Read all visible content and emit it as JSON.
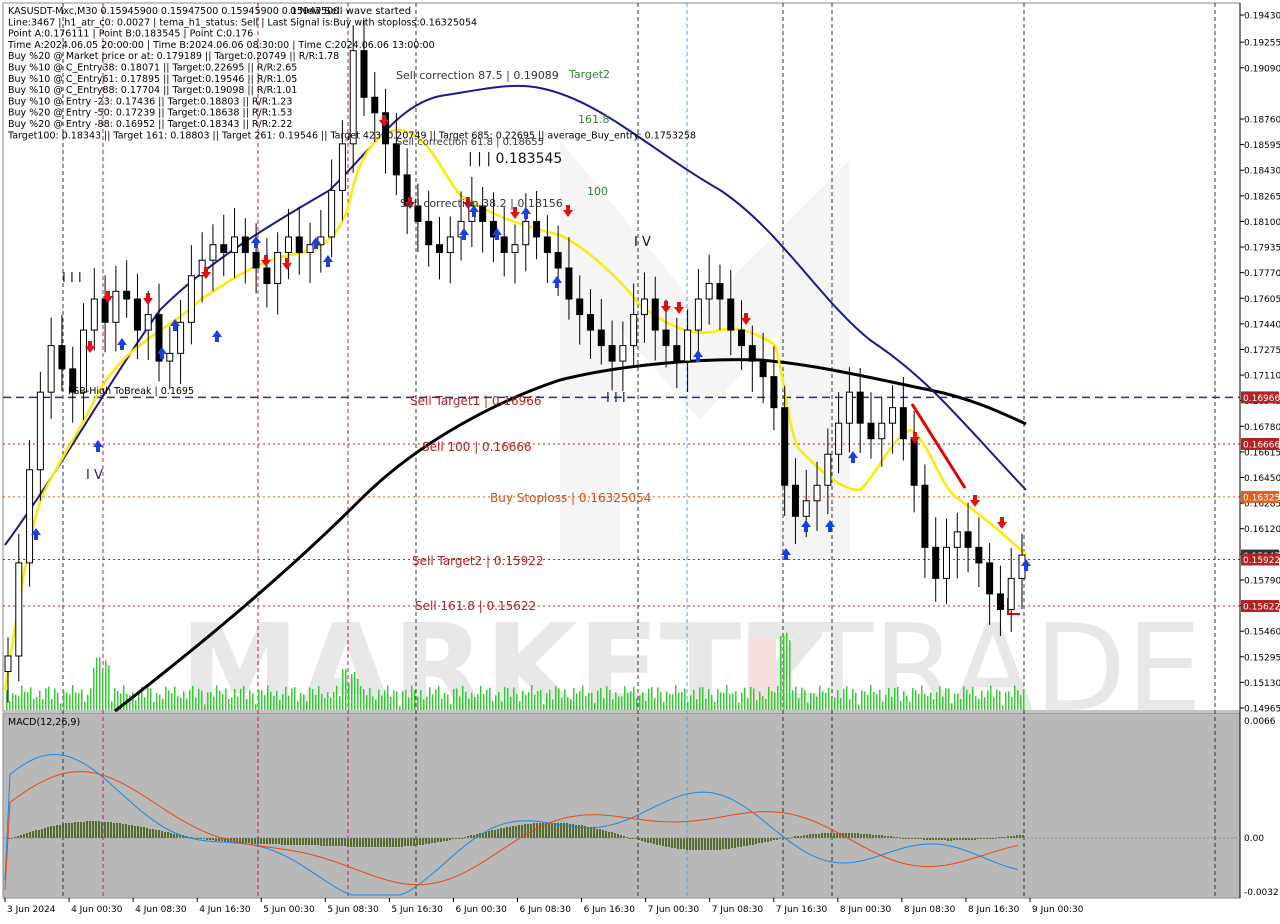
{
  "header": {
    "lines": [
      "KASUSDT-Mxc,M30  0.15945900 0.15947500 0.15945900 0.15947500",
      "Line:3467 | h1_atr_c0: 0.0027 | tema_h1_status: Sell | Last Signal is:Buy with stoploss:0.16325054",
      "Point A:0.176111 | Point B:0.183545 | Point C:0.176",
      "Time A:2024.06.05 20:00:00 | Time B:2024.06.06 08:30:00 | Time C:2024.06.06 13:00:00",
      "Buy %20 @ Market price or at: 0.179189 || Target:0.20749 || R/R:1.78",
      "Buy %10 @ C_Entry38: 0.18071 || Target:0.22695 || R/R:2.65",
      "Buy %10 @ C_Entry61: 0.17895 || Target:0.19546 || R/R:1.05",
      "Buy %10 @ C_Entry88: 0.17704 || Target:0.19098 || R/R:1.01",
      "Buy %10 @ Entry -23: 0.17436 || Target:0.18803 || R/R:1.23",
      "Buy %20 @ Entry -50: 0.17239 || Target:0.18638 || R/R:1.53",
      "Buy %20 @ Entry -88: 0.16952 || Target:0.18343 || R/R:2.22",
      "Target100: 0.18343 || Target 161: 0.18803 || Target 261: 0.19546 || Target 423: 0.20749 || Target 685: 0.22695 || average_Buy_entry: 0.1753258"
    ],
    "new_sell_wave": "0 New Sell wave started"
  },
  "chart_labels": {
    "sell_correction_875": "Sell correction 87.5 | 0.19089",
    "target2": "Target2",
    "fib_1618": "161.8",
    "sell_correction_618": "Sell correction 61.8 | 0.18655",
    "point_b_marker": "| | | 0.183545",
    "fib_100": "100",
    "sell_correction_382": "Sell correction 38.2 | 0.18156",
    "wave_iv": "I V",
    "wave_iii_left": "I I I",
    "wave_iii_right": "I I I",
    "wave_v": "I V",
    "fsb": "FSB-High ToBreak | 0.1695",
    "sell_target1": "Sell Target1 | 0.16966",
    "sell_100": "Sell 100 | 0.16666",
    "buy_stoploss": "Buy Stoploss | 0.16325054",
    "sell_target2": "Sell Target2 | 0.15922",
    "sell_1618": "Sell 161.8 | 0.15622",
    "watermark_left": "MARKETZ",
    "watermark_right": "TRADE",
    "macd_label": "MACD(12,26,9)"
  },
  "price_axis": {
    "ticks": [
      "0.19430",
      "0.19255",
      "0.19090",
      "0.18760",
      "0.18595",
      "0.18430",
      "0.18265",
      "0.18100",
      "0.17935",
      "0.17770",
      "0.17605",
      "0.17440",
      "0.17275",
      "0.17110",
      "0.16945",
      "0.16780",
      "0.16615",
      "0.16450",
      "0.16285",
      "0.16120",
      "0.15955",
      "0.15790",
      "0.15625",
      "0.15460",
      "0.15295",
      "0.15130",
      "0.14965"
    ],
    "tags": {
      "sell_target1": "0.16966",
      "sell_100": "0.16666",
      "buy_stoploss": "0.16325",
      "current": "0.15947",
      "sell_target2": "0.15922",
      "sell_1618": "0.15622"
    },
    "colors": {
      "sell_target1": "#b22222",
      "sell_100": "#b22222",
      "buy_stoploss": "#e06020",
      "current": "#333333",
      "sell_target2": "#b22222",
      "sell_1618": "#b22222"
    }
  },
  "macd_axis": {
    "ticks": [
      "0.0066",
      "0.00",
      "-0.0032"
    ]
  },
  "time_axis": {
    "labels": [
      "3 Jun 2024",
      "4 Jun 00:30",
      "4 Jun 08:30",
      "4 Jun 16:30",
      "5 Jun 00:30",
      "5 Jun 08:30",
      "5 Jun 16:30",
      "6 Jun 00:30",
      "6 Jun 08:30",
      "6 Jun 16:30",
      "7 Jun 00:30",
      "7 Jun 08:30",
      "7 Jun 16:30",
      "8 Jun 00:30",
      "8 Jun 08:30",
      "8 Jun 16:30",
      "9 Jun 00:30"
    ]
  },
  "chart_data": {
    "type": "candlestick",
    "symbol": "KASUSDT-Mxc",
    "timeframe": "M30",
    "y_range": [
      0.14965,
      0.1943
    ],
    "levels": [
      {
        "name": "Sell Target1",
        "value": 0.16966,
        "color": "#1f2f9f",
        "style": "dashed"
      },
      {
        "name": "Sell 100",
        "value": 0.16666,
        "color": "#b22222",
        "style": "dotted"
      },
      {
        "name": "Buy Stoploss",
        "value": 0.16325054,
        "color": "#e06020",
        "style": "dotted"
      },
      {
        "name": "Sell Target2",
        "value": 0.15922,
        "color": "#b22222",
        "style": "dotted"
      },
      {
        "name": "Sell 161.8",
        "value": 0.15622,
        "color": "#b22222",
        "style": "dotted"
      }
    ],
    "series": [
      {
        "name": "close",
        "values": [
          0.153,
          0.159,
          0.165,
          0.17,
          0.173,
          0.1715,
          0.17,
          0.174,
          0.176,
          0.1745,
          0.1765,
          0.176,
          0.174,
          0.175,
          0.172,
          0.1725,
          0.1745,
          0.1775,
          0.1785,
          0.1795,
          0.179,
          0.18,
          0.179,
          0.178,
          0.177,
          0.179,
          0.18,
          0.179,
          0.1795,
          0.18,
          0.183,
          0.186,
          0.192,
          0.189,
          0.188,
          0.186,
          0.184,
          0.182,
          0.181,
          0.1795,
          0.179,
          0.18,
          0.181,
          0.182,
          0.181,
          0.18,
          0.179,
          0.1795,
          0.181,
          0.18,
          0.179,
          0.178,
          0.176,
          0.175,
          0.174,
          0.173,
          0.172,
          0.173,
          0.175,
          0.176,
          0.174,
          0.173,
          0.172,
          0.174,
          0.176,
          0.177,
          0.176,
          0.174,
          0.173,
          0.172,
          0.171,
          0.169,
          0.164,
          0.162,
          0.163,
          0.164,
          0.166,
          0.168,
          0.17,
          0.168,
          0.167,
          0.168,
          0.169,
          0.167,
          0.164,
          0.16,
          0.158,
          0.16,
          0.161,
          0.16,
          0.159,
          0.157,
          0.156,
          0.158,
          0.1595
        ]
      }
    ]
  }
}
